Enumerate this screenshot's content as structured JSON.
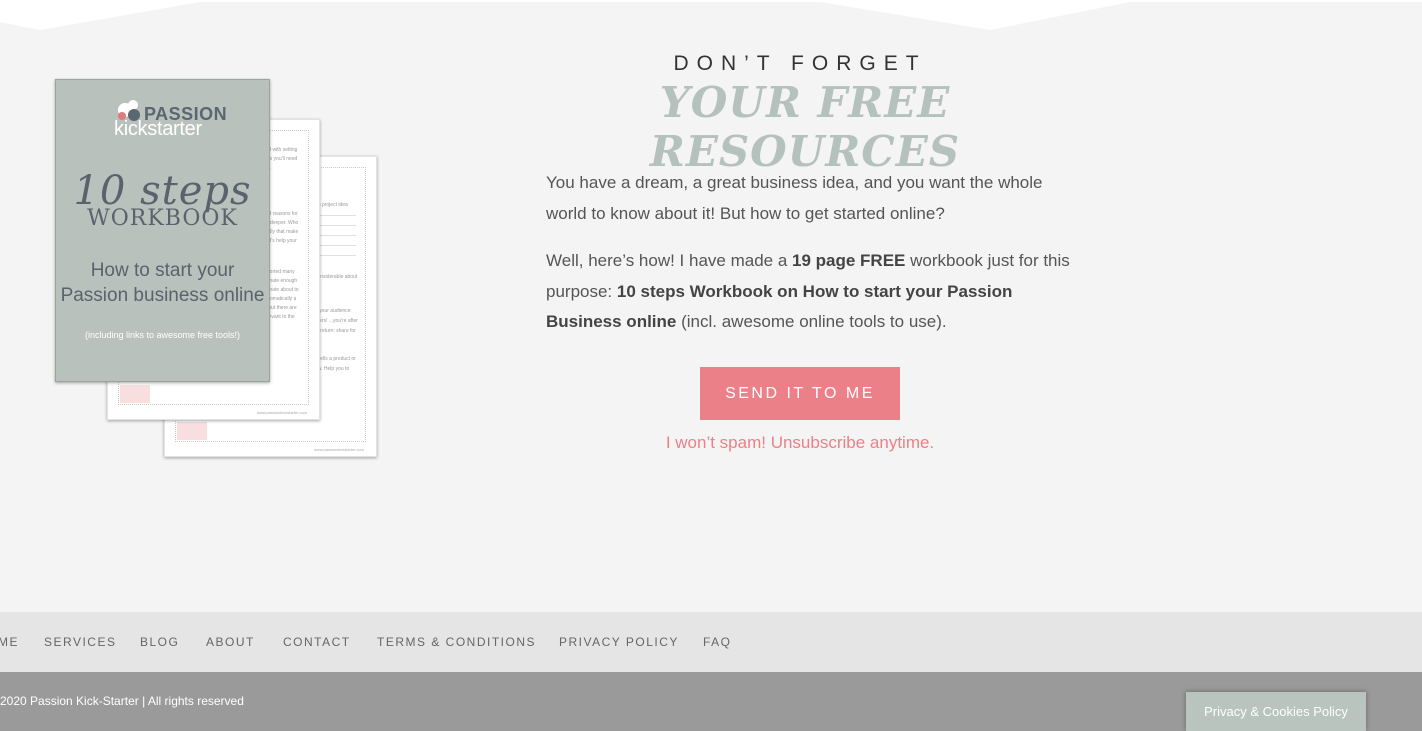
{
  "heading": {
    "eyebrow": "DON’T FORGET",
    "script_title": "YOUR FREE RESOURCES"
  },
  "workbook": {
    "brand_top": "PASSION",
    "brand_bottom": "kickstarter",
    "steps": "10 steps",
    "workbook_word": "WORKBOOK",
    "subtitle_line1": "How to start your",
    "subtitle_line2": "Passion business online",
    "note": "(including links to awesome free tools!)"
  },
  "intro": {
    "p1": "You have a dream, a great business idea, and you want the whole world to know about it! But how to get started online?",
    "p2_a": "Well, here’s how! I have made a ",
    "p2_b": "19 page FREE",
    "p2_c": " workbook just for this purpose: ",
    "p2_d": "10 steps Workbook on How to start your Passion Business online",
    "p2_e": " (incl. awesome online tools to use)."
  },
  "cta": {
    "button": "SEND IT TO ME",
    "note": "I won’t spam! Unsubscribe anytime."
  },
  "footer": {
    "nav": [
      "ME",
      "SERVICES",
      "BLOG",
      "ABOUT",
      "CONTACT",
      "TERMS & CONDITIONS",
      "PRIVACY POLICY",
      "FAQ"
    ],
    "copyright": "2020 Passion Kick-Starter | All rights reserved"
  },
  "cookie_button": "Privacy & Cookies Policy",
  "colors": {
    "accent_pink": "#ec8088",
    "sage": "#b5c1bc",
    "background": "#f4f4f4"
  }
}
